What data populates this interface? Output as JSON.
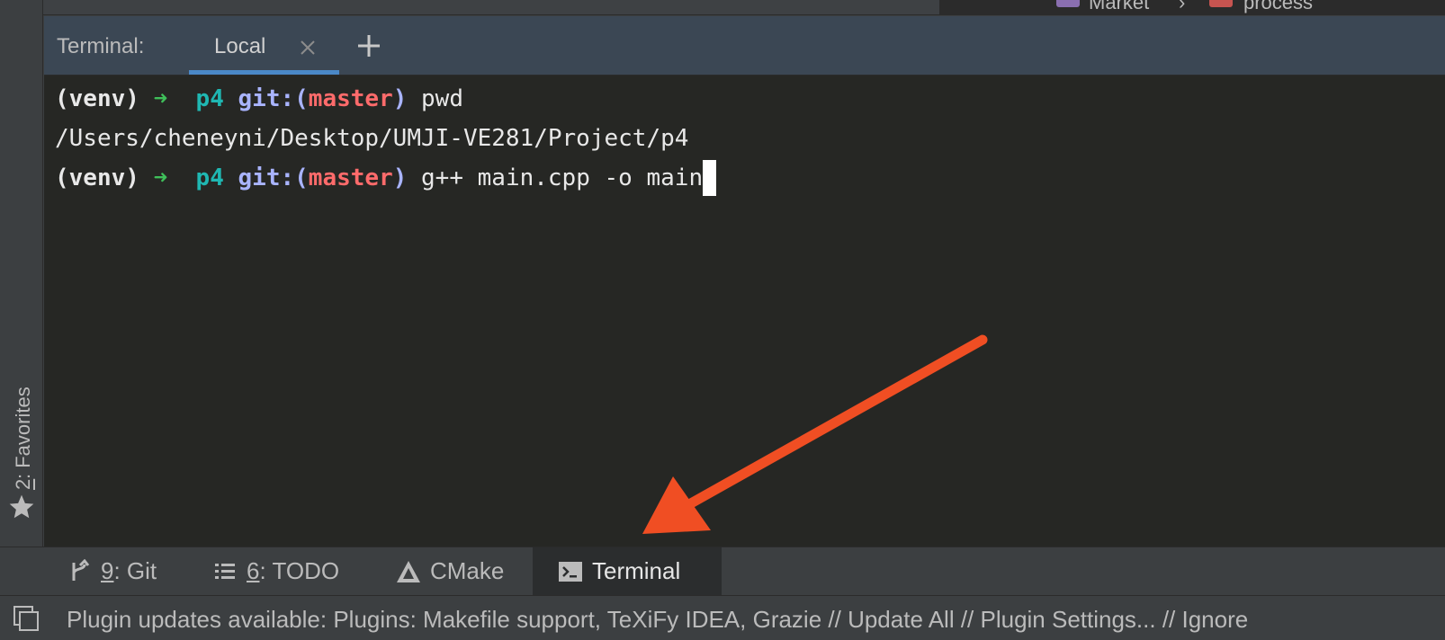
{
  "top_crumbs": {
    "item1": "Market",
    "sep": "›",
    "item2": "process"
  },
  "favorites": {
    "number": "2",
    "label": ": Favorites"
  },
  "terminal": {
    "title": "Terminal:",
    "tabs": [
      {
        "label": "Local",
        "active": true
      }
    ],
    "lines": [
      {
        "venv": "(venv) ",
        "arrow": "➜  ",
        "dir": "p4 ",
        "git_open": "git:(",
        "branch": "master",
        "git_close": ")",
        "command": " pwd"
      },
      {
        "output": "/Users/cheneyni/Desktop/UMJI-VE281/Project/p4"
      },
      {
        "venv": "(venv) ",
        "arrow": "➜  ",
        "dir": "p4 ",
        "git_open": "git:(",
        "branch": "master",
        "git_close": ")",
        "command": " g++ main.cpp -o main"
      }
    ]
  },
  "tool_windows": [
    {
      "icon": "git-branch-icon",
      "number": "9",
      "label": ": Git",
      "active": false
    },
    {
      "icon": "todo-list-icon",
      "number": "6",
      "label": ": TODO",
      "active": false
    },
    {
      "icon": "cmake-icon",
      "number": "",
      "label": "CMake",
      "active": false
    },
    {
      "icon": "terminal-icon",
      "number": "",
      "label": "Terminal",
      "active": true
    }
  ],
  "status_bar": {
    "message": "Plugin updates available: Plugins: Makefile support, TeXiFy IDEA, Grazie // Update All // Plugin Settings... // Ignore"
  },
  "colors": {
    "terminal_bg": "#262724",
    "header_bg": "#3b4754",
    "tab_underline": "#4a88c7",
    "prompt_arrow": "#3fbf5a",
    "prompt_dir": "#1fb7b2",
    "prompt_git": "#a9b4ff",
    "prompt_branch": "#ff6b6b",
    "annotation_arrow": "#f04e23"
  }
}
